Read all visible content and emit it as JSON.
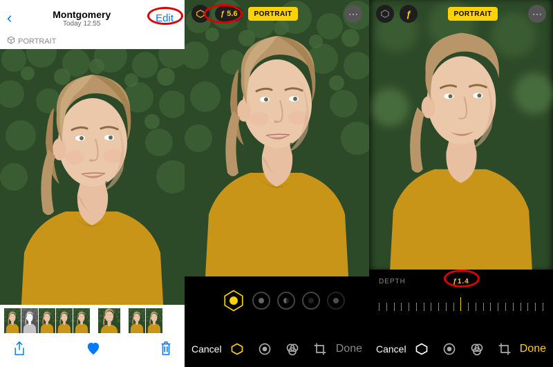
{
  "pane1": {
    "title": "Montgomery",
    "subtitle": "Today 12:55",
    "edit_label": "Edit",
    "portrait_badge": "PORTRAIT"
  },
  "pane2": {
    "f_value": "ƒ 5.6",
    "portrait_badge": "PORTRAIT",
    "cancel_label": "Cancel",
    "done_label": "Done"
  },
  "pane3": {
    "portrait_badge": "PORTRAIT",
    "depth_label": "DEPTH",
    "depth_value": "ƒ1.4",
    "cancel_label": "Cancel",
    "done_label": "Done"
  },
  "colors": {
    "ios_blue": "#007aff",
    "ios_yellow": "#fed100",
    "annotation_red": "#d00"
  }
}
